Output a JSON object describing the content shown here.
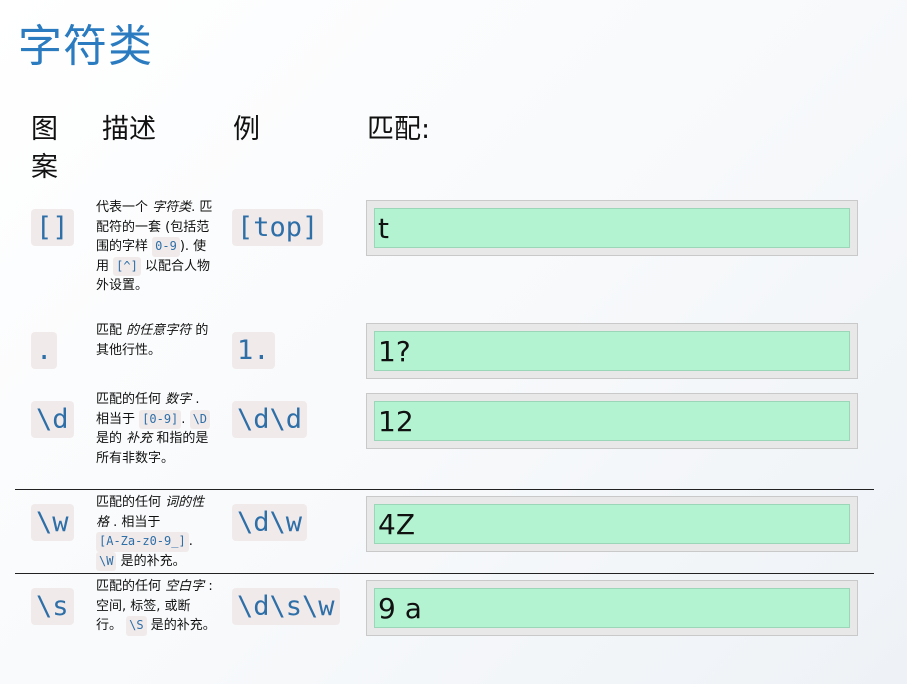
{
  "title": "字符类",
  "headers": {
    "pattern": "图案",
    "description": "描述",
    "example": "例",
    "match": "匹配:"
  },
  "rows": [
    {
      "pattern": "[]",
      "desc": {
        "t1": "代表一个",
        "em1": "字符类",
        "t2": ". 匹配符的一套 (包括范围的字样",
        "c1": "0-9",
        "t3": "). 使用",
        "c2": "[^]",
        "t4": "以配合人物外设置。"
      },
      "example": "[top]",
      "match": "t"
    },
    {
      "pattern": ".",
      "desc": {
        "t1": "匹配",
        "em1": "的任意字符",
        "t2": "的其他行性。"
      },
      "example": "1.",
      "match": "1?"
    },
    {
      "pattern": "\\d",
      "desc": {
        "t1": "匹配的任何",
        "em1": "数字",
        "t2": ". 相当于",
        "c1": "[0-9]",
        "t3": ".",
        "c2": "\\D",
        "t4": "是的",
        "em2": "补充",
        "t5": "和指的是所有非数字。"
      },
      "example": "\\d\\d",
      "match": "12"
    },
    {
      "pattern": "\\w",
      "desc": {
        "t1": "匹配的任何",
        "em1": "词的性格",
        "t2": ". 相当于",
        "c1": "[A-Za-z0-9_]",
        "t3": ".",
        "c2": "\\W",
        "t4": "是的补充。"
      },
      "example": "\\d\\w",
      "match": "4Z"
    },
    {
      "pattern": "\\s",
      "desc": {
        "t1": "匹配的任何",
        "em1": "空白字",
        "t2": ": 空间, 标签, 或断行。",
        "c1": "\\S",
        "t3": "是的补充。"
      },
      "example": "\\d\\s\\w",
      "match": "9 a"
    }
  ]
}
